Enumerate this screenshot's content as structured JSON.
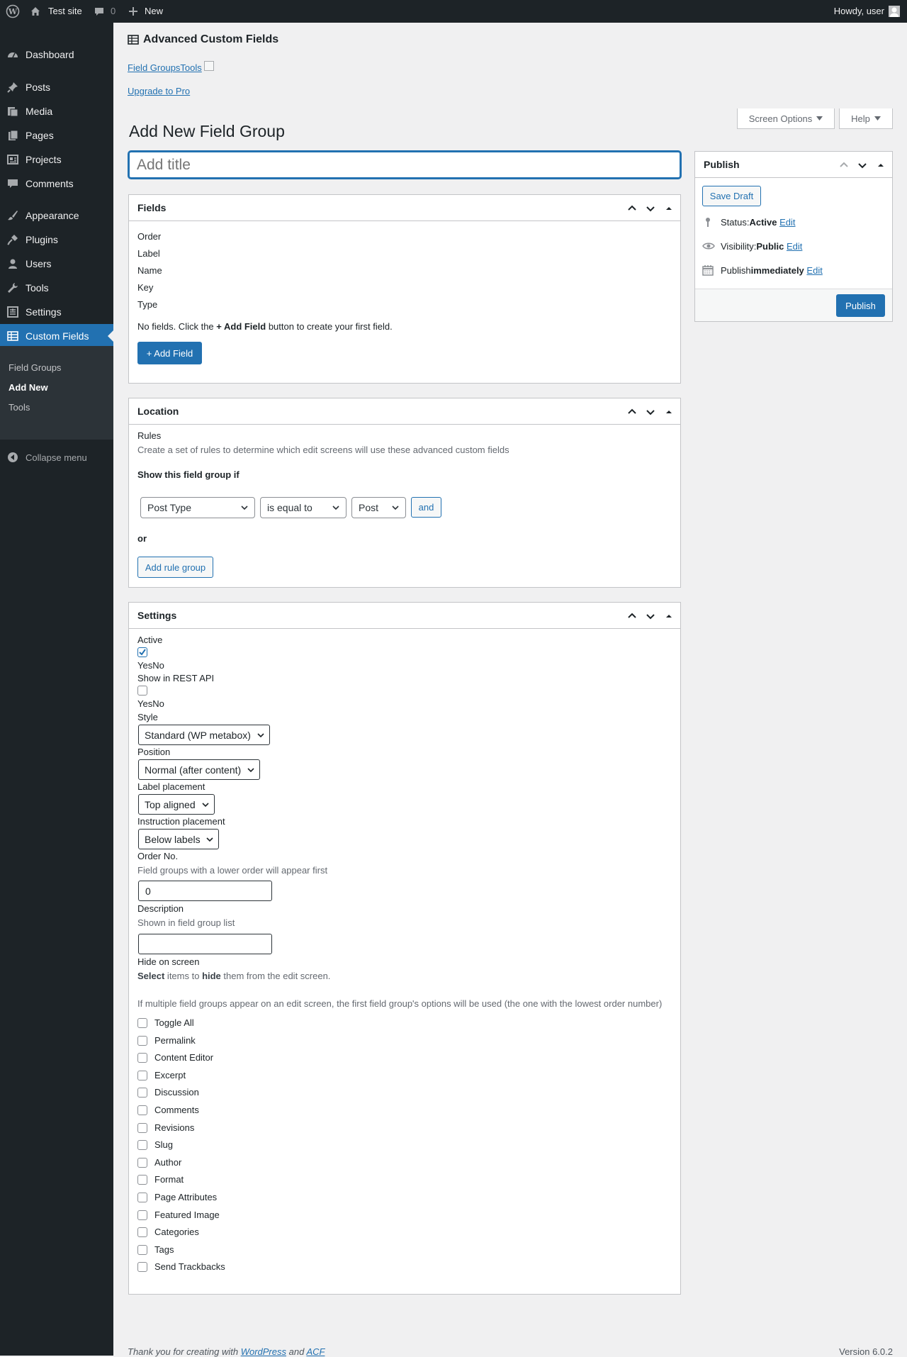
{
  "adminbar": {
    "site_name": "Test site",
    "comments_count": "0",
    "new_label": "New",
    "greeting": "Howdy, user"
  },
  "sidebar": {
    "items": [
      {
        "label": "Dashboard",
        "icon": "dashboard-icon"
      },
      {
        "label": "Posts",
        "icon": "pin-icon"
      },
      {
        "label": "Media",
        "icon": "media-icon"
      },
      {
        "label": "Pages",
        "icon": "pages-icon"
      },
      {
        "label": "Projects",
        "icon": "portfolio-icon"
      },
      {
        "label": "Comments",
        "icon": "comment-icon"
      },
      {
        "label": "Appearance",
        "icon": "brush-icon"
      },
      {
        "label": "Plugins",
        "icon": "plugin-icon"
      },
      {
        "label": "Users",
        "icon": "user-icon"
      },
      {
        "label": "Tools",
        "icon": "wrench-icon"
      },
      {
        "label": "Settings",
        "icon": "settings-icon"
      },
      {
        "label": "Custom Fields",
        "icon": "table-icon"
      }
    ],
    "submenu": [
      "Field Groups",
      "Add New",
      "Tools"
    ],
    "collapse_label": "Collapse menu"
  },
  "header": {
    "plugin_title": "Advanced Custom Fields",
    "nav_field_groups": "Field Groups",
    "nav_tools": "Tools",
    "upgrade_link": "Upgrade to Pro",
    "screen_options": "Screen Options",
    "help": "Help",
    "page_title": "Add New Field Group",
    "title_placeholder": "Add title"
  },
  "fields_box": {
    "title": "Fields",
    "columns": [
      "Order",
      "Label",
      "Name",
      "Key",
      "Type"
    ],
    "empty_prefix": "No fields. Click the ",
    "empty_bold": "+ Add Field",
    "empty_suffix": " button to create your first field.",
    "add_button": "+ Add Field"
  },
  "location_box": {
    "title": "Location",
    "rules_label": "Rules",
    "rules_desc": "Create a set of rules to determine which edit screens will use these advanced custom fields",
    "show_if": "Show this field group if",
    "param": "Post Type",
    "operator": "is equal to",
    "value": "Post",
    "and_button": "and",
    "or_label": "or",
    "add_rule_group": "Add rule group"
  },
  "settings_box": {
    "title": "Settings",
    "active_label": "Active",
    "active_checked": true,
    "active_yesno": "YesNo",
    "rest_label": "Show in REST API",
    "rest_checked": false,
    "rest_yesno": "YesNo",
    "style_label": "Style",
    "style_value": "Standard (WP metabox)",
    "position_label": "Position",
    "position_value": "Normal (after content)",
    "label_placement_label": "Label placement",
    "label_placement_value": "Top aligned",
    "instruction_placement_label": "Instruction placement",
    "instruction_placement_value": "Below labels",
    "order_label": "Order No.",
    "order_desc": "Field groups with a lower order will appear first",
    "order_value": "0",
    "description_label": "Description",
    "description_desc": "Shown in field group list",
    "description_value": "",
    "hide_label": "Hide on screen",
    "hide_desc_b1": "Select",
    "hide_desc_t1": " items to ",
    "hide_desc_b2": "hide",
    "hide_desc_t2": " them from the edit screen.",
    "hide_note": "If multiple field groups appear on an edit screen, the first field group's options will be used (the one with the lowest order number)",
    "hide_items": [
      "Toggle All",
      "Permalink",
      "Content Editor",
      "Excerpt",
      "Discussion",
      "Comments",
      "Revisions",
      "Slug",
      "Author",
      "Format",
      "Page Attributes",
      "Featured Image",
      "Categories",
      "Tags",
      "Send Trackbacks"
    ]
  },
  "publish_box": {
    "title": "Publish",
    "save_draft": "Save Draft",
    "status_label": "Status: ",
    "status_value": "Active",
    "visibility_label": "Visibility: ",
    "visibility_value": "Public",
    "publish_label": "Publish ",
    "publish_value": "immediately",
    "edit_link": "Edit",
    "publish_button": "Publish"
  },
  "footer": {
    "thanks_prefix": "Thank you for creating with ",
    "wordpress": "WordPress",
    "and": " and ",
    "acf": "ACF",
    "version": "Version 6.0.2"
  },
  "colors": {
    "accent": "#2271b1",
    "admin_bar": "#1d2327",
    "page_bg": "#f0f0f1"
  }
}
